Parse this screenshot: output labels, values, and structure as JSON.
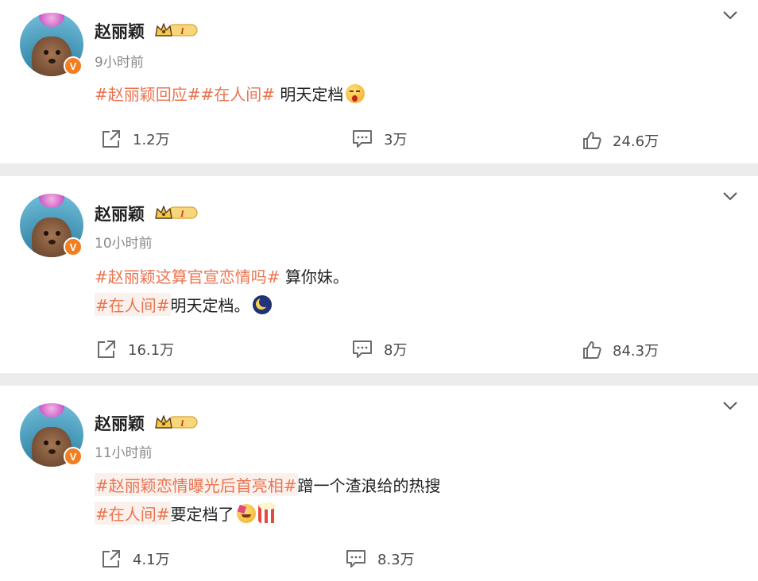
{
  "posts": [
    {
      "author": "赵丽颖",
      "time": "9小时前",
      "lines": [
        [
          {
            "t": "#赵丽颖回应#",
            "tag": true
          },
          {
            "t": "#在人间#",
            "tag": true
          },
          {
            "t": " 明天定档",
            "tag": false
          }
        ]
      ],
      "emojis": [
        [
          "sleepy-face-emoji"
        ]
      ],
      "actions": {
        "repost": "1.2万",
        "comment": "3万",
        "like": "24.6万"
      }
    },
    {
      "author": "赵丽颖",
      "time": "10小时前",
      "lines": [
        [
          {
            "t": "#赵丽颖这算官宣恋情吗#",
            "tag": true
          },
          {
            "t": " 算你妹。",
            "tag": false
          }
        ],
        [
          {
            "t": "#在人间#",
            "tag": true
          },
          {
            "t": "明天定档。",
            "tag": false
          }
        ]
      ],
      "emojis": [
        [],
        [
          "moon-night-emoji"
        ]
      ],
      "actions": {
        "repost": "16.1万",
        "comment": "8万",
        "like": "84.3万"
      }
    },
    {
      "author": "赵丽颖",
      "time": "11小时前",
      "lines": [
        [
          {
            "t": "#赵丽颖恋情曝光后首亮相#",
            "tag": true
          },
          {
            "t": "蹭一个渣浪给的热搜",
            "tag": false
          }
        ],
        [
          {
            "t": "#在人间#",
            "tag": true
          },
          {
            "t": "要定档了",
            "tag": false
          }
        ]
      ],
      "emojis": [
        [],
        [
          "party-face-emoji",
          "popcorn-emoji"
        ]
      ],
      "actions": {
        "repost": "4.1万",
        "comment": "8.3万",
        "like": ""
      }
    }
  ],
  "colors": {
    "topic": "#eb7350",
    "verified_badge": "#f27e1f",
    "text": "#222222",
    "meta": "#8a8a8a",
    "divider": "#ececec"
  },
  "verified_badge_letter": "V",
  "member_badge_label": "I",
  "icons": [
    "chevron-down-icon",
    "repost-icon",
    "comment-icon",
    "like-icon",
    "crown-icon",
    "verified-icon"
  ]
}
